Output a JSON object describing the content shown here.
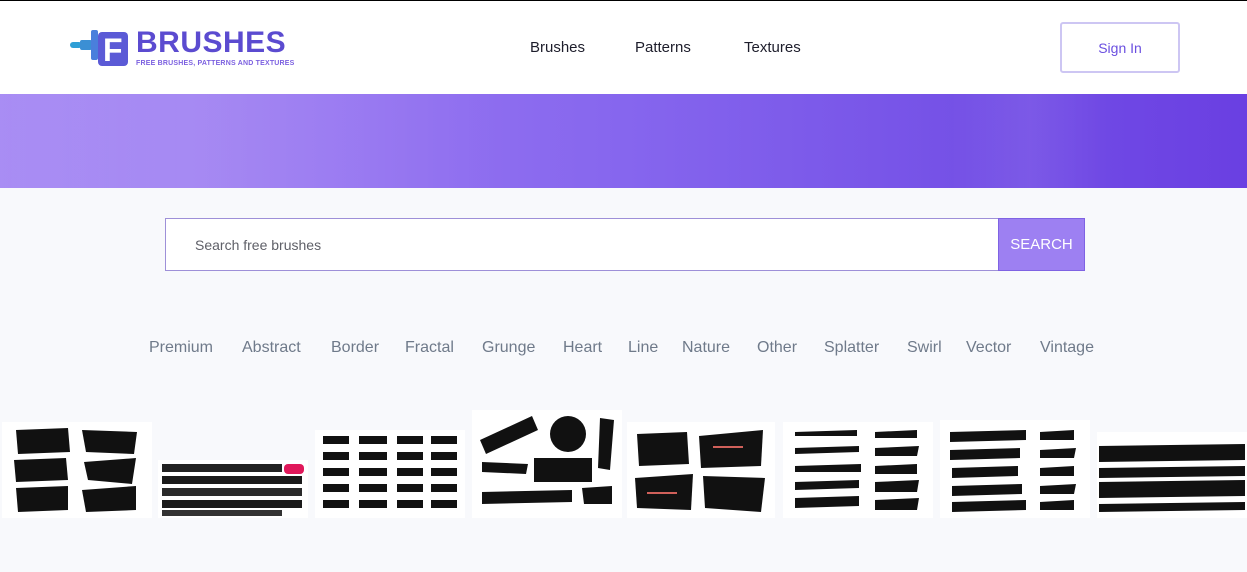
{
  "logo": {
    "wordmark": "FBRUSHES",
    "tagline": "FREE BRUSHES, PATTERNS AND TEXTURES"
  },
  "nav": [
    {
      "label": "Brushes"
    },
    {
      "label": "Patterns"
    },
    {
      "label": "Textures"
    }
  ],
  "signin_label": "Sign In",
  "search": {
    "placeholder": "Search free brushes",
    "value": "",
    "button_label": "SEARCH"
  },
  "categories": [
    "Premium",
    "Abstract",
    "Border",
    "Fractal",
    "Grunge",
    "Heart",
    "Line",
    "Nature",
    "Other",
    "Splatter",
    "Swirl",
    "Vector",
    "Vintage"
  ],
  "thumbnails": [
    {
      "name": "brush-thumb-1"
    },
    {
      "name": "brush-thumb-2"
    },
    {
      "name": "brush-thumb-3"
    },
    {
      "name": "brush-thumb-4"
    },
    {
      "name": "brush-thumb-5"
    },
    {
      "name": "brush-thumb-6"
    },
    {
      "name": "brush-thumb-7"
    },
    {
      "name": "brush-thumb-8"
    }
  ],
  "colors": {
    "accent": "#6a4fe0",
    "hero_start": "#a487f3",
    "hero_end": "#6a3fe2",
    "search_button": "#9d80f2"
  },
  "icons": {
    "logo": "paintbrush-icon"
  }
}
